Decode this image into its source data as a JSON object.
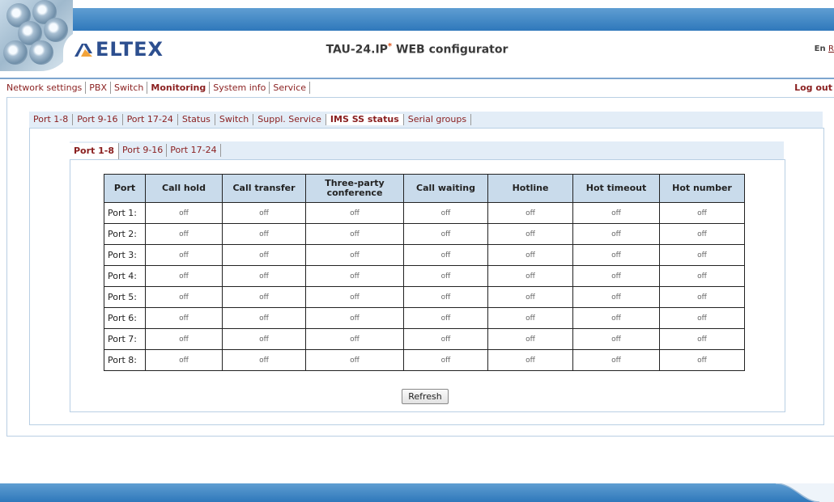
{
  "header": {
    "logo_text": "ELTEX",
    "title_main": "TAU-24.IP",
    "title_star": "*",
    "title_rest": " WEB configurator",
    "lang_en": "En",
    "lang_ru": "R",
    "brand_color": "#2f78bb"
  },
  "main_menu": {
    "items": [
      {
        "label": "Network settings"
      },
      {
        "label": "PBX"
      },
      {
        "label": "Switch"
      },
      {
        "label": "Monitoring",
        "active": true
      },
      {
        "label": "System info"
      },
      {
        "label": "Service"
      }
    ],
    "logout": "Log out"
  },
  "sub_tabs": [
    {
      "label": "Port 1-8"
    },
    {
      "label": "Port 9-16"
    },
    {
      "label": "Port 17-24"
    },
    {
      "label": "Status"
    },
    {
      "label": "Switch"
    },
    {
      "label": "Suppl. Service"
    },
    {
      "label": "IMS SS status",
      "active": true
    },
    {
      "label": "Serial groups"
    }
  ],
  "port_tabs": [
    {
      "label": "Port 1-8",
      "active": true
    },
    {
      "label": "Port 9-16"
    },
    {
      "label": "Port 17-24"
    }
  ],
  "table": {
    "columns": [
      "Port",
      "Call hold",
      "Call transfer",
      "Three-party conference",
      "Call waiting",
      "Hotline",
      "Hot timeout",
      "Hot number"
    ],
    "rows": [
      [
        "Port 1:",
        "off",
        "off",
        "off",
        "off",
        "off",
        "off",
        "off"
      ],
      [
        "Port 2:",
        "off",
        "off",
        "off",
        "off",
        "off",
        "off",
        "off"
      ],
      [
        "Port 3:",
        "off",
        "off",
        "off",
        "off",
        "off",
        "off",
        "off"
      ],
      [
        "Port 4:",
        "off",
        "off",
        "off",
        "off",
        "off",
        "off",
        "off"
      ],
      [
        "Port 5:",
        "off",
        "off",
        "off",
        "off",
        "off",
        "off",
        "off"
      ],
      [
        "Port 6:",
        "off",
        "off",
        "off",
        "off",
        "off",
        "off",
        "off"
      ],
      [
        "Port 7:",
        "off",
        "off",
        "off",
        "off",
        "off",
        "off",
        "off"
      ],
      [
        "Port 8:",
        "off",
        "off",
        "off",
        "off",
        "off",
        "off",
        "off"
      ]
    ]
  },
  "refresh_label": "Refresh",
  "icons": {
    "logo": "eltex-logo-icon",
    "header_decoration": "discs-decoration-icon"
  }
}
